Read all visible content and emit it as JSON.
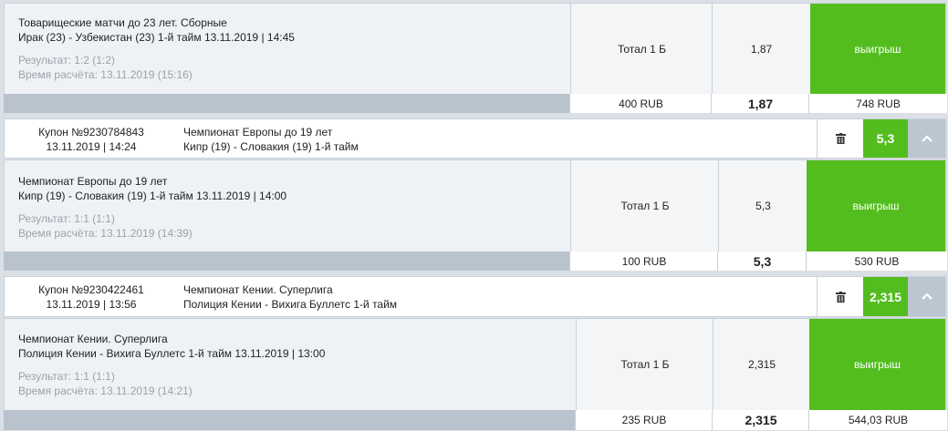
{
  "bet1": {
    "league": "Товарищеские матчи до 23 лет. Сборные",
    "match": "Ирак (23) - Узбекистан (23) 1-й тайм 13.11.2019 | 14:45",
    "result": "Результат: 1:2 (1:2)",
    "calc_time": "Время расчёта: 13.11.2019 (15:16)",
    "market": "Тотал 1 Б",
    "odds": "1,87",
    "status": "выигрыш",
    "stake": "400 RUB",
    "total_odds": "1,87",
    "payout": "748 RUB"
  },
  "coupon2": {
    "number": "Купон №9230784843",
    "datetime": "13.11.2019 | 14:24",
    "league": "Чемпионат Европы до 19 лет",
    "match": "Кипр (19) - Словакия (19) 1-й тайм",
    "odds": "5,3"
  },
  "bet2": {
    "league": "Чемпионат Европы до 19 лет",
    "match": "Кипр (19) - Словакия (19) 1-й тайм 13.11.2019 | 14:00",
    "result": "Результат: 1:1 (1:1)",
    "calc_time": "Время расчёта: 13.11.2019 (14:39)",
    "market": "Тотал 1 Б",
    "odds": "5,3",
    "status": "выигрыш",
    "stake": "100 RUB",
    "total_odds": "5,3",
    "payout": "530 RUB"
  },
  "coupon3": {
    "number": "Купон №9230422461",
    "datetime": "13.11.2019 | 13:56",
    "league": "Чемпионат Кении. Суперлига",
    "match": "Полиция Кении - Вихига Буллетс 1-й тайм",
    "odds": "2,315"
  },
  "bet3": {
    "league": "Чемпионат Кении. Суперлига",
    "match": "Полиция Кении - Вихига Буллетс 1-й тайм 13.11.2019 | 13:00",
    "result": "Результат: 1:1 (1:1)",
    "calc_time": "Время расчёта: 13.11.2019 (14:21)",
    "market": "Тотал 1 Б",
    "odds": "2,315",
    "status": "выигрыш",
    "stake": "235 RUB",
    "total_odds": "2,315",
    "payout": "544,03 RUB"
  },
  "icons": {
    "trash": "trash-icon",
    "chevron": "chevron-up-icon"
  },
  "colors": {
    "win": "#53bd1f",
    "footer": "#b8c3ce",
    "panel": "#eef2f5"
  }
}
